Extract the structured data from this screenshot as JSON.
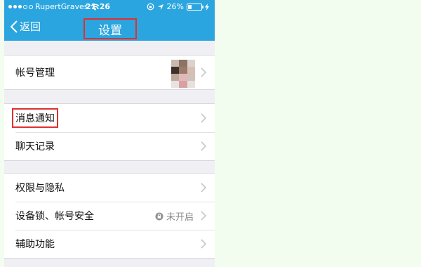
{
  "status_bar": {
    "carrier": "RupertGraves",
    "time": "21:26",
    "battery": "26%"
  },
  "nav": {
    "back_label": "返回",
    "title": "设置"
  },
  "groups": [
    {
      "items": [
        {
          "label": "帐号管理",
          "has_avatar": true
        }
      ]
    },
    {
      "items": [
        {
          "label": "消息通知",
          "highlighted": true
        },
        {
          "label": "聊天记录"
        }
      ]
    },
    {
      "items": [
        {
          "label": "权限与隐私"
        },
        {
          "label": "设备锁、帐号安全",
          "status": "未开启"
        },
        {
          "label": "辅助功能"
        }
      ]
    }
  ],
  "colors": {
    "nav_blue": "#2ba5df",
    "highlight_red": "#e03030",
    "page_bg": "#f2fdf0"
  }
}
